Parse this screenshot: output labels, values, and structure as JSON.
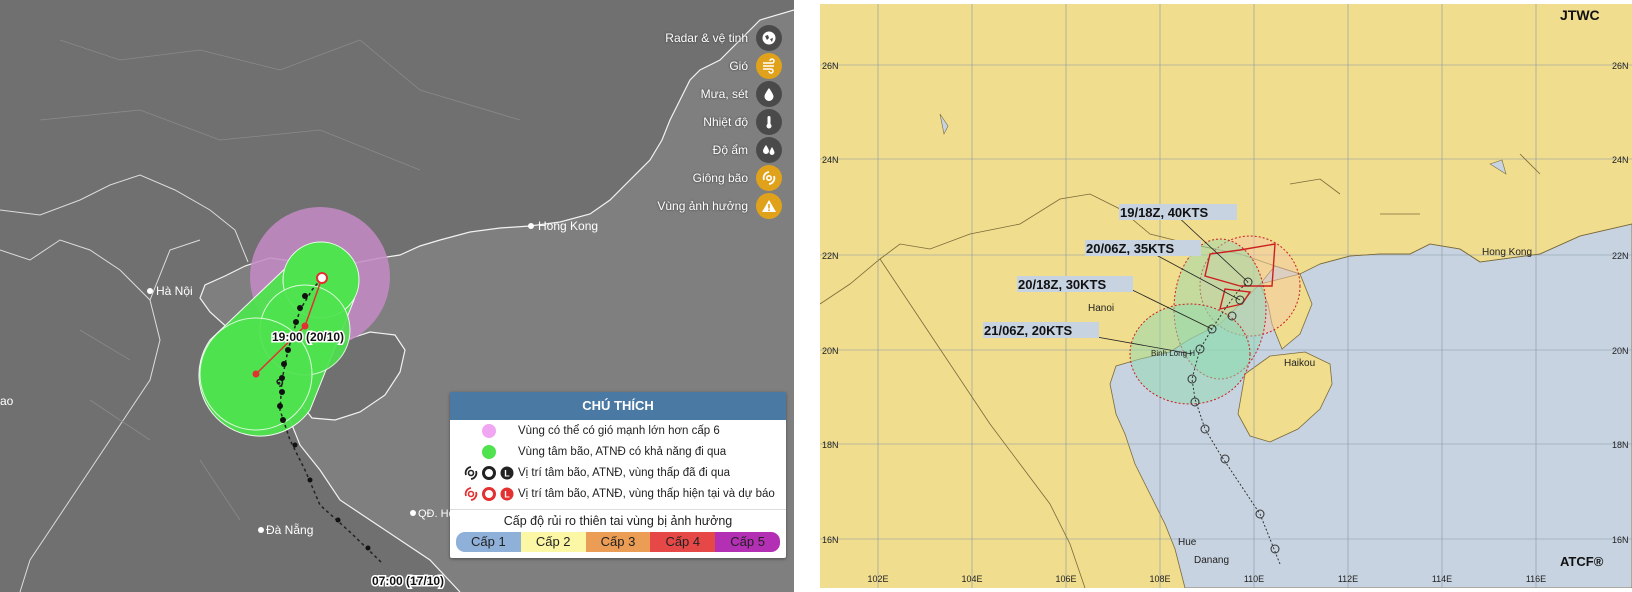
{
  "left_map": {
    "place_labels": {
      "hanoi": "Hà Nội",
      "hongkong": "Hong Kong",
      "danang": "Đà Nẵng",
      "lao": "ao",
      "hoangsa": "QĐ. Ho"
    },
    "time_labels": {
      "forecast": "19:00 (20/10)",
      "start": "07:00 (17/10)"
    },
    "layers": [
      {
        "label": "Radar & vệ tinh",
        "icon": "globe-icon",
        "active": false
      },
      {
        "label": "Gió",
        "icon": "wind-icon",
        "active": true
      },
      {
        "label": "Mưa, sét",
        "icon": "raindrop-icon",
        "active": false
      },
      {
        "label": "Nhiệt độ",
        "icon": "thermometer-icon",
        "active": false
      },
      {
        "label": "Độ ẩm",
        "icon": "humidity-icon",
        "active": false
      },
      {
        "label": "Giông bão",
        "icon": "storm-icon",
        "active": false
      },
      {
        "label": "Vùng ảnh hưởng",
        "icon": "warning-icon",
        "active": false
      }
    ],
    "legend": {
      "title": "CHÚ THÍCH",
      "items": [
        {
          "label": "Vùng có thể có gió mạnh lớn hơn cấp 6"
        },
        {
          "label": "Vùng tâm bão, ATNĐ có khả năng đi qua"
        },
        {
          "label": "Vị trí tâm bão, ATNĐ, vùng thấp đã đi qua"
        },
        {
          "label": "Vị trí tâm bão, ATNĐ, vùng thấp hiện tại và dự báo"
        }
      ],
      "icon_letter": "L",
      "risk_title": "Cấp độ rủi ro thiên tai vùng bị ảnh hưởng",
      "risk_levels": [
        {
          "label": "Cấp 1",
          "color": "#8fb0d8"
        },
        {
          "label": "Cấp 2",
          "color": "#fbf7a4"
        },
        {
          "label": "Cấp 3",
          "color": "#eb9d55"
        },
        {
          "label": "Cấp 4",
          "color": "#e64848"
        },
        {
          "label": "Cấp 5",
          "color": "#b32fb3"
        }
      ]
    },
    "colors": {
      "wind_zone": "#c68ac6",
      "cone": "#4fe34f",
      "track": "#222222",
      "current": "#e33030"
    }
  },
  "right_map": {
    "agency": "JTWC",
    "credit": "ATCF®",
    "lat_labels": [
      "26N",
      "24N",
      "22N",
      "20N",
      "18N",
      "16N"
    ],
    "lon_labels": [
      "102E",
      "104E",
      "106E",
      "108E",
      "110E",
      "112E",
      "114E",
      "116E"
    ],
    "forecast_labels": [
      "19/18Z,  40KTS",
      "20/06Z,  35KTS",
      "20/18Z,  30KTS",
      "21/06Z,  20KTS"
    ],
    "place_labels": {
      "hongkong": "Hong Kong",
      "hanoi": "Hanoi",
      "haikou": "Haikou",
      "hue": "Hue",
      "danang": "Danang",
      "binhlongh": "Binh Long H"
    },
    "colors": {
      "land": "#f0dd8e",
      "sea": "#c7d3e0",
      "wind_radii": "#cc1f1f"
    }
  }
}
